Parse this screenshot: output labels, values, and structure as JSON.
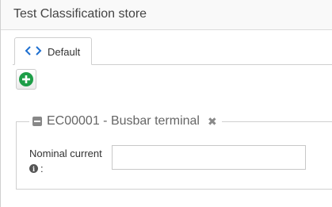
{
  "panel": {
    "title": "Test Classification store"
  },
  "tabs": [
    {
      "label": "Default",
      "icon": "code-icon",
      "active": true
    }
  ],
  "toolbar": {
    "add_icon": "plus-circle-icon",
    "add_color": "#1e9e48"
  },
  "section": {
    "legend": "EC00001 - Busbar terminal",
    "collapse_icon": "minus-square-icon",
    "remove_icon": "close-icon"
  },
  "fields": [
    {
      "label": "Nominal current",
      "suffix": ":",
      "info_icon": "info-circle-icon",
      "value": ""
    }
  ],
  "colors": {
    "accent_blue": "#1e6fd0",
    "add_green": "#1e9e48"
  }
}
